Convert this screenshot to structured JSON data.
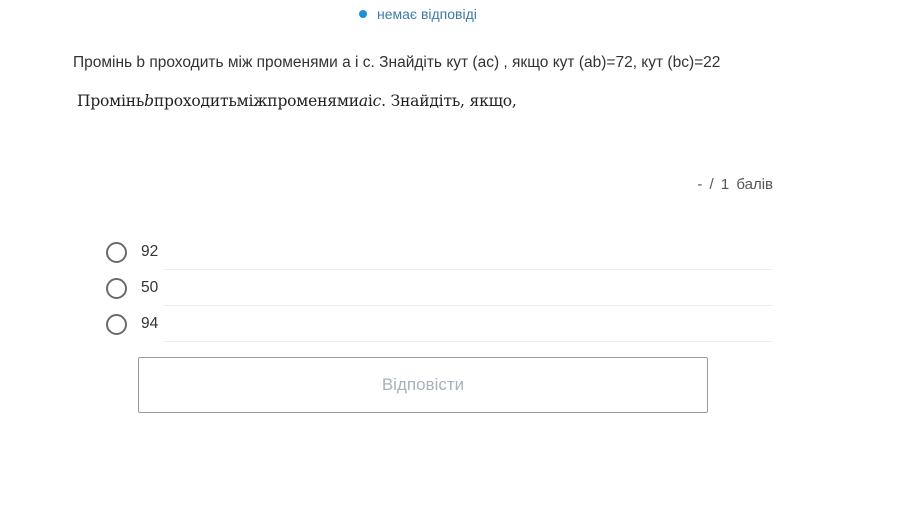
{
  "status": {
    "text": "немає відповіді",
    "dot_color": "#1d8fdc"
  },
  "question": {
    "text": "Промінь b проходить між променями a і c. Знайдіть кут (ac) , якщо кут (ab)=72, кут (bc)=22",
    "math_parts": [
      "Промінь",
      "b",
      "проходитьміжпроменями",
      "a",
      "і",
      "c",
      ". Знайдіть, якщо,"
    ]
  },
  "score": {
    "text": "- / 1 балів"
  },
  "options": [
    {
      "label": "92",
      "selected": false
    },
    {
      "label": "50",
      "selected": false
    },
    {
      "label": "94",
      "selected": false
    }
  ],
  "submit": {
    "label": "Відповісти"
  }
}
